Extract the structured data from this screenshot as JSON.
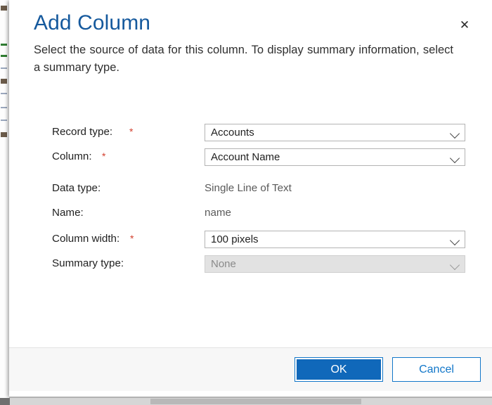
{
  "dialog": {
    "title": "Add Column",
    "description": "Select the source of data for this column. To display summary information, select a summary type.",
    "close_icon": "close-icon",
    "close_glyph": "✕"
  },
  "form": {
    "required_marker": "*",
    "rows": [
      {
        "key": "record_type",
        "label": "Record type:",
        "required": true,
        "control": "dropdown",
        "value": "Accounts",
        "disabled": false
      },
      {
        "key": "column",
        "label": "Column:",
        "required": true,
        "control": "dropdown",
        "value": "Account Name",
        "disabled": false
      },
      {
        "key": "data_type",
        "label": "Data type:",
        "required": false,
        "control": "static",
        "value": "Single Line of Text",
        "disabled": false
      },
      {
        "key": "name",
        "label": "Name:",
        "required": false,
        "control": "static",
        "value": "name",
        "disabled": false
      },
      {
        "key": "column_width",
        "label": "Column width:",
        "required": true,
        "control": "dropdown",
        "value": "100 pixels",
        "disabled": false
      },
      {
        "key": "summary_type",
        "label": "Summary type:",
        "required": false,
        "control": "dropdown",
        "value": "None",
        "disabled": true
      }
    ]
  },
  "footer": {
    "ok_label": "OK",
    "cancel_label": "Cancel"
  },
  "colors": {
    "title_blue": "#15599d",
    "accent_blue": "#1068ba",
    "link_blue": "#1277c9",
    "required_red": "#d3402f",
    "footer_bg": "#f7f7f7",
    "disabled_bg": "#e2e2e2"
  }
}
